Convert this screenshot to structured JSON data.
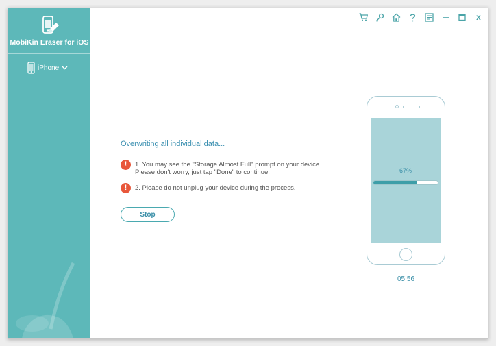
{
  "app": {
    "name": "MobiKin Eraser for iOS",
    "icons": {
      "logo": "phone-eraser-icon",
      "device": "phone-icon"
    }
  },
  "sidebar": {
    "device_label": "iPhone",
    "device_icon": "phone-icon",
    "dropdown_icon": "chevron-down-icon"
  },
  "titlebar": {
    "icons": [
      "cart-icon",
      "key-icon",
      "home-icon",
      "help-icon",
      "feedback-icon",
      "minimize-icon",
      "maximize-icon",
      "close-icon"
    ],
    "close_label": "x"
  },
  "main": {
    "status_title": "Overwriting all individual data...",
    "notices": [
      {
        "icon": "warning-icon",
        "mark": "!",
        "lines": [
          "1. You may see the \"Storage Almost Full\" prompt on your device.",
          "Please don't worry, just tap \"Done\" to continue."
        ]
      },
      {
        "icon": "warning-icon",
        "mark": "!",
        "lines": [
          "2. Please do not unplug your device during the process."
        ]
      }
    ],
    "stop_label": "Stop"
  },
  "phone": {
    "progress_label": "67%",
    "progress_fraction": 0.67,
    "timer": "05:56"
  },
  "colors": {
    "sidebar": "#5db8b9",
    "accent": "#3a8fb0",
    "warning": "#e8573b",
    "phone_screen": "#a9d4d9",
    "progress_fill": "#3d9ea8"
  }
}
